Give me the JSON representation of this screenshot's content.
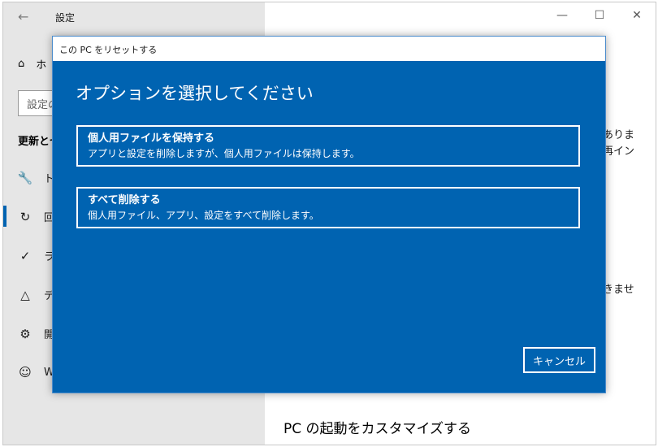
{
  "window": {
    "title": "設定",
    "back_icon": "back-arrow-icon",
    "controls": {
      "minimize": "—",
      "maximize": "☐",
      "close": "✕"
    }
  },
  "sidebar": {
    "home_label": "ホ",
    "search_placeholder": "設定の",
    "section_heading": "更新とセ",
    "items": [
      {
        "icon": "wrench-icon",
        "label": "ト"
      },
      {
        "icon": "recovery-icon",
        "label": "回"
      },
      {
        "icon": "check-circle-icon",
        "label": "ラ"
      },
      {
        "icon": "developer-icon",
        "label": "デ"
      },
      {
        "icon": "tools-icon",
        "label": "開"
      },
      {
        "icon": "cat-icon",
        "label": "W"
      }
    ]
  },
  "right_pane": {
    "fragment_top_1": "ありま",
    "fragment_top_2": "再イン",
    "fragment_mid": "きませ",
    "bottom_heading": "PC の起動をカスタマイズする"
  },
  "dialog": {
    "title": "この PC をリセットする",
    "heading": "オプションを選択してください",
    "options": [
      {
        "title": "個人用ファイルを保持する",
        "description": "アプリと設定を削除しますが、個人用ファイルは保持します。"
      },
      {
        "title": "すべて削除する",
        "description": "個人用ファイル、アプリ、設定をすべて削除します。"
      }
    ],
    "cancel_label": "キャンセル"
  },
  "colors": {
    "dialog_bg": "#0063b1",
    "sidebar_bg": "#e6e6e6",
    "accent": "#0063b1"
  }
}
